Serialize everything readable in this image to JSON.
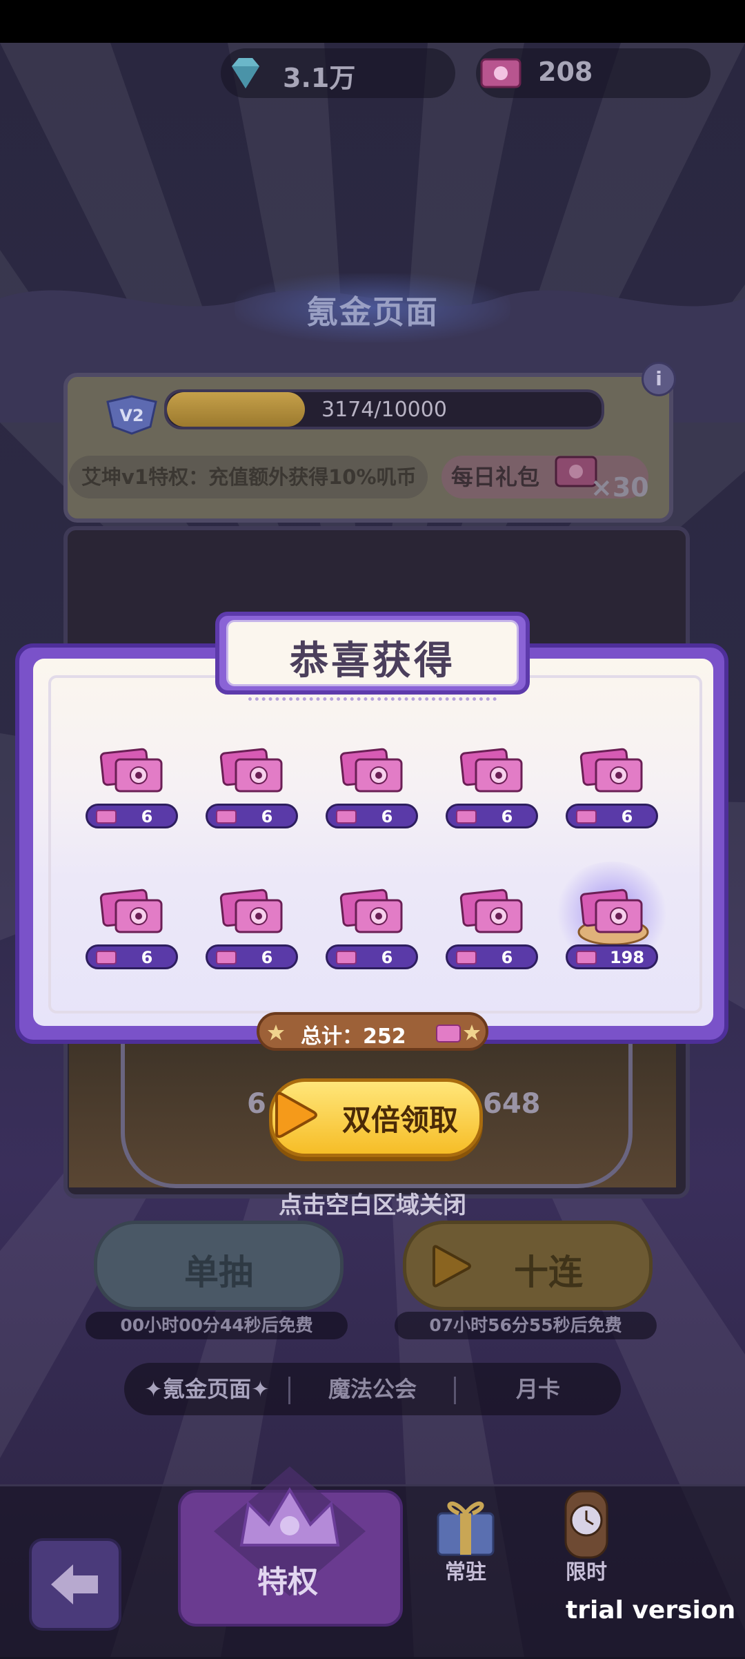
{
  "currency": {
    "gems": "3.1万",
    "tickets": "208"
  },
  "page_title": "氪金页面",
  "vip": {
    "level": "V2",
    "progress_text": "3174/10000",
    "progress": 0.3174,
    "privilege_text": "艾坤v1特权：充值额外获得10%叽币",
    "daily_label": "每日礼包",
    "daily_count": "×30"
  },
  "modal": {
    "title": "恭喜获得",
    "rewards": [
      {
        "value": "6"
      },
      {
        "value": "6"
      },
      {
        "value": "6"
      },
      {
        "value": "6"
      },
      {
        "value": "6"
      },
      {
        "value": "6"
      },
      {
        "value": "6"
      },
      {
        "value": "6"
      },
      {
        "value": "6"
      },
      {
        "value": "198"
      }
    ],
    "total_text": "总计：252",
    "double_claim_label": "双倍领取"
  },
  "banner": {
    "count_left": "6",
    "count_right": "648"
  },
  "close_hint": "点击空白区域关闭",
  "draw": {
    "single_label": "单抽",
    "ten_label": "十连",
    "single_timer": "00小时00分44秒后免费",
    "ten_timer": "07小时56分55秒后免费"
  },
  "tabs": [
    {
      "label": "✦氪金页面✦"
    },
    {
      "label": "魔法公会"
    },
    {
      "label": "月卡"
    }
  ],
  "bottom_nav": {
    "privilege": "特权",
    "regular": "常驻",
    "limited": "限时"
  },
  "watermark": "trial version",
  "colors": {
    "accent_purple": "#7a52c9",
    "gold": "#f6bd27",
    "pink_ticket": "#e27cc6"
  }
}
